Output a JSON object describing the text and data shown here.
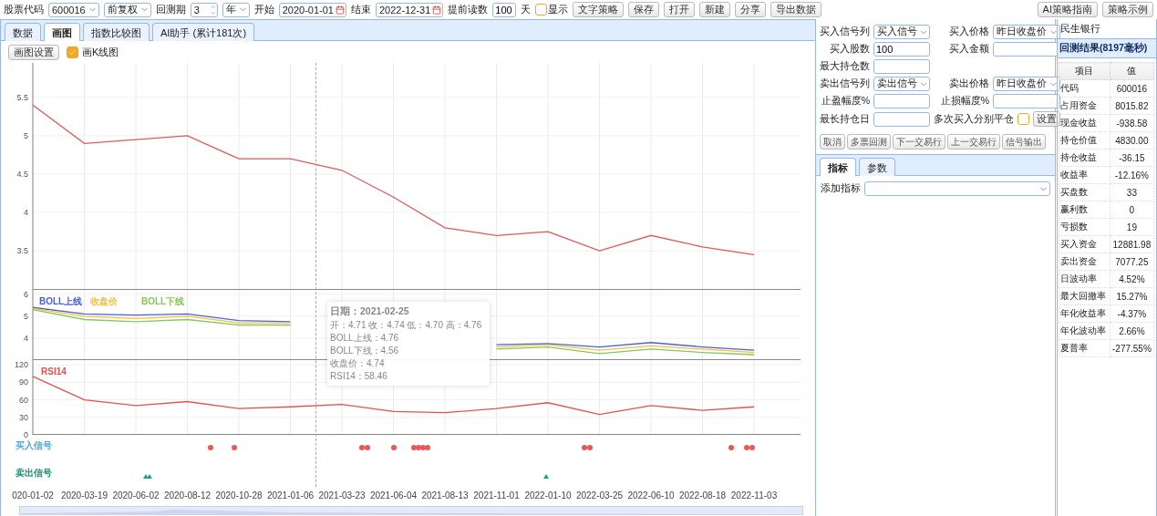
{
  "toolbar": [
    {
      "kind": "label",
      "text": "股票代码"
    },
    {
      "kind": "select",
      "value": "600016"
    },
    {
      "kind": "select",
      "value": "前复权"
    },
    {
      "kind": "label",
      "text": "回测期"
    },
    {
      "kind": "spinner",
      "value": "3"
    },
    {
      "kind": "select",
      "value": "年"
    },
    {
      "kind": "label",
      "text": "开始"
    },
    {
      "kind": "date",
      "value": "2020-01-01"
    },
    {
      "kind": "label",
      "text": "结束"
    },
    {
      "kind": "date",
      "value": "2022-12-31"
    },
    {
      "kind": "label",
      "text": "提前读数"
    },
    {
      "kind": "input",
      "value": "100"
    },
    {
      "kind": "label",
      "text": "天"
    },
    {
      "kind": "checkbox",
      "text": "显示",
      "checked": false
    },
    {
      "kind": "button",
      "text": "文字策略"
    },
    {
      "kind": "button",
      "text": "保存"
    },
    {
      "kind": "button",
      "text": "打开"
    },
    {
      "kind": "button",
      "text": "新建"
    },
    {
      "kind": "button",
      "text": "分享"
    },
    {
      "kind": "button",
      "text": "导出数据"
    }
  ],
  "toolbar_right": [
    "AI策略指南",
    "策略示例"
  ],
  "tabs": [
    {
      "label": "数据",
      "selected": false
    },
    {
      "label": "画图",
      "selected": true
    },
    {
      "label": "指数比较图",
      "selected": false
    },
    {
      "label": "AI助手 (累计181次)",
      "selected": false
    }
  ],
  "chart_toolbar": {
    "settings_button": "画图设置",
    "kline": {
      "label": "画K线图",
      "checked": true
    }
  },
  "charts": [
    {
      "chart_data": {
        "type": "line",
        "ylim": [
          2.99,
          5.95
        ],
        "yticks": [
          3.5,
          4,
          4.5,
          5,
          5.5
        ],
        "grid": true,
        "series": [
          {
            "color": "#e05a5a",
            "values": [
              5.4,
              4.9,
              4.95,
              5.0,
              4.7,
              4.7,
              4.55,
              4.2,
              3.8,
              3.7,
              3.75,
              3.5,
              3.7,
              3.55,
              3.45
            ]
          }
        ]
      }
    },
    {
      "chart_data": {
        "type": "line",
        "ylim": [
          3,
          6.2
        ],
        "yticks": [
          4,
          5,
          6
        ],
        "grid": true,
        "series": [
          {
            "name": "BOLL上线",
            "color": "#4a62d0",
            "values": [
              5.4,
              5.1,
              5.05,
              5.1,
              4.8,
              4.75,
              null,
              null,
              null,
              3.7,
              3.75,
              3.6,
              3.8,
              3.6,
              3.45
            ]
          },
          {
            "name": "收盘价",
            "color": "#f2c043",
            "values": [
              5.35,
              5.0,
              4.9,
              5.0,
              4.7,
              4.7,
              null,
              null,
              null,
              3.6,
              3.7,
              3.45,
              3.65,
              3.5,
              3.35
            ]
          },
          {
            "name": "BOLL下线",
            "color": "#86c85a",
            "values": [
              5.3,
              4.85,
              4.75,
              4.85,
              4.6,
              4.6,
              null,
              null,
              null,
              3.5,
              3.6,
              3.3,
              3.5,
              3.35,
              3.25
            ]
          }
        ]
      }
    },
    {
      "chart_data": {
        "type": "line",
        "ylim": [
          0,
          128
        ],
        "yticks": [
          0,
          30,
          60,
          90,
          120
        ],
        "grid": true,
        "series": [
          {
            "name": "RSI14",
            "color": "#e85050",
            "values": [
              100,
              60,
              50,
              57,
              45,
              48,
              52,
              40,
              38,
              45,
              55,
              35,
              50,
              42,
              48
            ]
          }
        ]
      }
    }
  ],
  "signals": [
    {
      "label": "买入信号",
      "kind": "dots",
      "color": "#4aa8d8"
    },
    {
      "label": "卖出信号",
      "kind": "triangles",
      "color": "#1a9070"
    }
  ],
  "x_axis": [
    "020-01-02",
    "2020-03-19",
    "2020-06-02",
    "2020-08-12",
    "2020-10-28",
    "2021-01-06",
    "2021-03-23",
    "2021-06-04",
    "2021-08-13",
    "2021-11-01",
    "2022-01-10",
    "2022-03-25",
    "2022-06-10",
    "2022-08-18",
    "2022-11-03"
  ],
  "tooltip": {
    "title": "日期：2021-02-25",
    "lines": [
      "开：4.71 收：4.74 低：4.70 高：4.76",
      "BOLL上线：4.76",
      "BOLL下线：4.56",
      "收盘价：4.74",
      "RSI14：58.46"
    ]
  },
  "form_rows": [
    [
      {
        "label": "买入信号列",
        "kind": "select",
        "value": "买入信号"
      },
      {
        "label": "买入价格",
        "kind": "select",
        "value": "昨日收盘价"
      }
    ],
    [
      {
        "label": "买入股数",
        "kind": "input",
        "value": "100"
      },
      {
        "label": "买入金额",
        "kind": "input"
      }
    ],
    [
      {
        "label": "最大持仓数",
        "kind": "input"
      }
    ],
    [
      {
        "label": "卖出信号列",
        "kind": "select",
        "value": "卖出信号"
      },
      {
        "label": "卖出价格",
        "kind": "select",
        "value": "昨日收盘价"
      }
    ],
    [
      {
        "label": "止盈幅度%",
        "kind": "input"
      },
      {
        "label": "止损幅度%",
        "kind": "input"
      }
    ],
    [
      {
        "label": "最长持仓日",
        "kind": "input"
      },
      {
        "label": "多次买入分别平仓",
        "kind": "checkbox",
        "checked": false,
        "button": "设置"
      }
    ]
  ],
  "action_buttons": [
    "取消",
    "多票回测",
    "下一交易行",
    "上一交易行",
    "信号输出"
  ],
  "sub_tabs": [
    {
      "label": "指标",
      "selected": true
    },
    {
      "label": "参数",
      "selected": false
    }
  ],
  "add_indicator_label": "添加指标",
  "stock_name": "民生银行",
  "result_title": "回测结果(8197毫秒)",
  "result_table": {
    "columns": [
      "项目",
      "值"
    ],
    "rows": [
      [
        "代码",
        "600016"
      ],
      [
        "占用资金",
        "8015.82"
      ],
      [
        "现金收益",
        "-938.58"
      ],
      [
        "持仓价值",
        "4830.00"
      ],
      [
        "持仓收益",
        "-36.15"
      ],
      [
        "收益率",
        "-12.16%"
      ],
      [
        "买盘数",
        "33"
      ],
      [
        "赢利数",
        "0"
      ],
      [
        "亏损数",
        "19"
      ],
      [
        "买入资金",
        "12881.98"
      ],
      [
        "卖出资金",
        "7077.25"
      ],
      [
        "日波动率",
        "4.52%"
      ],
      [
        "最大回撤率",
        "15.27%"
      ],
      [
        "年化收益率",
        "-4.37%"
      ],
      [
        "年化波动率",
        "2.66%"
      ],
      [
        "夏普率",
        "-277.55%"
      ]
    ]
  }
}
